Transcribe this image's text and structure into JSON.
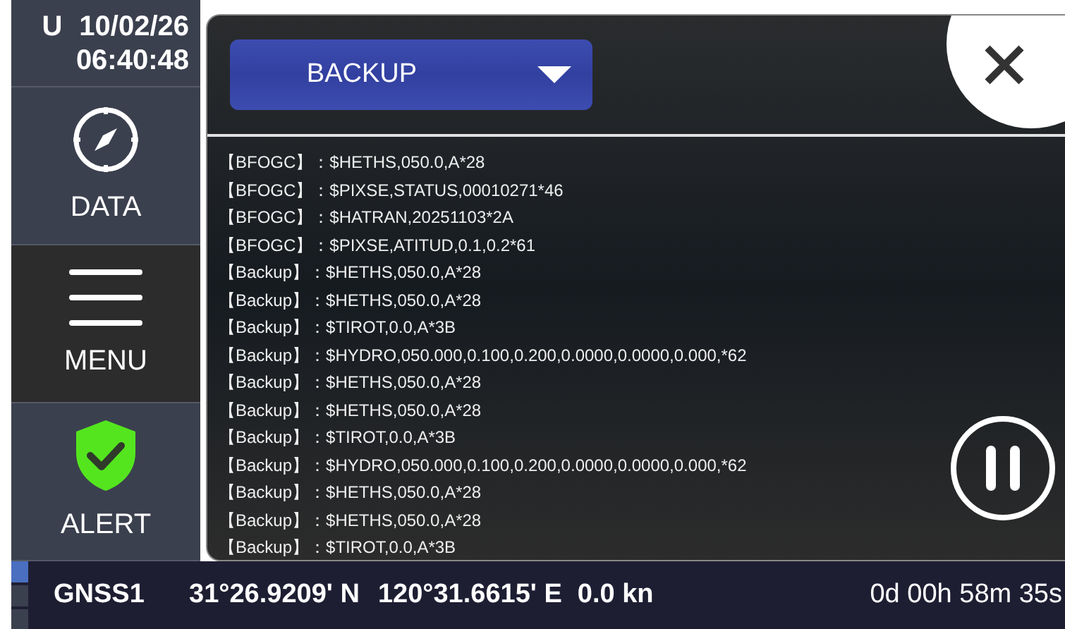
{
  "clock": {
    "mode": "U",
    "date": "10/02/26",
    "time": "06:40:48"
  },
  "sidebar": {
    "items": [
      {
        "kind": "compass",
        "label": "DATA",
        "selected": false
      },
      {
        "kind": "menu",
        "label": "MENU",
        "selected": true
      },
      {
        "kind": "shield",
        "label": "ALERT",
        "selected": false
      }
    ]
  },
  "dropdown": {
    "value": "BACKUP"
  },
  "log": [
    "【BFOGC】：$HETHS,050.0,A*28",
    "【BFOGC】：$PIXSE,STATUS,00010271*46",
    "【BFOGC】：$HATRAN,20251103*2A",
    "【BFOGC】：$PIXSE,ATITUD,0.1,0.2*61",
    "【Backup】：$HETHS,050.0,A*28",
    "【Backup】：$HETHS,050.0,A*28",
    "【Backup】：$TIROT,0.0,A*3B",
    "【Backup】：$HYDRO,050.000,0.100,0.200,0.0000,0.0000,0.000,*62",
    "【Backup】：$HETHS,050.0,A*28",
    "【Backup】：$HETHS,050.0,A*28",
    "【Backup】：$TIROT,0.0,A*3B",
    "【Backup】：$HYDRO,050.000,0.100,0.200,0.0000,0.0000,0.000,*62",
    "【Backup】：$HETHS,050.0,A*28",
    "【Backup】：$HETHS,050.0,A*28",
    "【Backup】：$TIROT,0.0,A*3B"
  ],
  "status_bar": {
    "source": "GNSS1",
    "latitude": "31°26.9209' N",
    "longitude": "120°31.6615' E",
    "speed": "0.0 kn",
    "elapsed": "0d 00h 58m 35s"
  }
}
